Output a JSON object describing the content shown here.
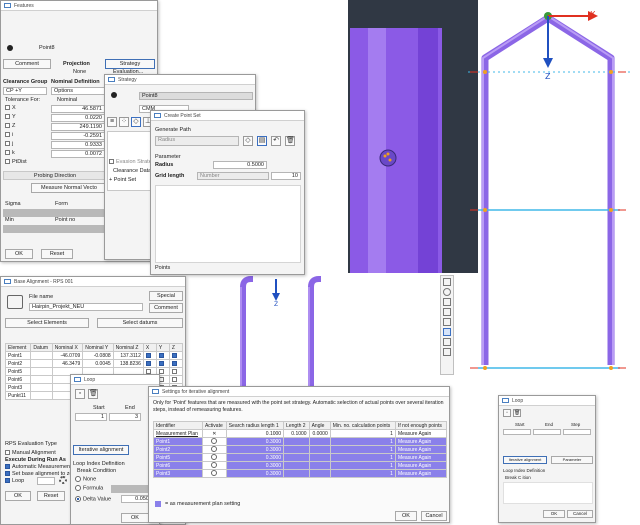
{
  "features_win": {
    "title": "Features",
    "item": "Point8",
    "tabs": [
      "Comment",
      "Projection",
      "Strategy"
    ],
    "projection_value": "None",
    "strategy_value": "Evaluation...",
    "clearance_group_label": "Clearance Group",
    "clearance_group_value": "CP +Y",
    "nominal_def_label": "Nominal Definition",
    "nominal_def_value": "Options",
    "tolerance_label": "Tolerance For:",
    "nominal_label": "Nominal",
    "rows": [
      {
        "label": "X",
        "value": "46.5871"
      },
      {
        "label": "Y",
        "value": "0.0220"
      },
      {
        "label": "Z",
        "value": "249.1190"
      },
      {
        "label": "i",
        "value": "-0.2591"
      },
      {
        "label": "j",
        "value": "0.9333"
      },
      {
        "label": "k",
        "value": "0.0072"
      }
    ],
    "ptdist_label": "PtDist",
    "probing_direction": "Probing Direction",
    "measure_normal": "Measure Normal Vecto",
    "sigma": "Sigma",
    "form": "Form",
    "min": "Min",
    "point_no": "Point no",
    "ok": "OK",
    "reset": "Reset"
  },
  "strategy_win": {
    "title": "Strategy",
    "item": "Point8",
    "mode": "CMM",
    "evasion": "Evasion Strate",
    "clearance_data": "Clearance Data",
    "point_set": "Point Set"
  },
  "create_pointset_win": {
    "title": "Create Point Set",
    "generate_path": "Generate Path",
    "path_value": "Radius",
    "parameter": "Parameter",
    "radius_label": "Radius",
    "radius_value": "0.5000",
    "grid_label": "Grid length",
    "grid_mode": "Number",
    "grid_value": "10",
    "points": "Points"
  },
  "viewport_right": {
    "x_label": "X",
    "z_label": "Z"
  },
  "viewport_bottom": {
    "z_label": "Z"
  },
  "base_alignment_win": {
    "title": "Base Alignment - RPS 001",
    "file_name_label": "File name",
    "file_name_value": "Hairpin_Projekt_NEU",
    "special": "Special",
    "comment": "Comment",
    "select_elements": "Select Elements",
    "select_datums": "Select datums",
    "columns": [
      "Element",
      "Datum",
      "Nominal X",
      "Nominal Y",
      "Nominal Z",
      "X",
      "Y",
      "Z"
    ],
    "rows": [
      {
        "element": "Point1",
        "datum": "",
        "nx": "-46.0709",
        "ny": "-0.0808",
        "nz": "137.3112"
      },
      {
        "element": "Point2",
        "datum": "",
        "nx": "46.3479",
        "ny": "0.0045",
        "nz": "138.8236"
      },
      {
        "element": "Point5",
        "datum": "",
        "nx": "",
        "ny": "",
        "nz": ""
      },
      {
        "element": "Point6",
        "datum": "",
        "nx": "",
        "ny": "",
        "nz": ""
      },
      {
        "element": "Point3",
        "datum": "",
        "nx": "",
        "ny": "",
        "nz": ""
      },
      {
        "element": "Punkt11",
        "datum": "",
        "nx": "",
        "ny": "",
        "nz": ""
      }
    ],
    "rps_eval_type": "RPS Evaluation Type",
    "manual_alignment": "Manual Alignment",
    "execute_during_run": "Execute During Run As",
    "automatic_measurement": "Automatic Measurement",
    "set_base_alignment": "Set base alignment to zero",
    "loop": "Loop",
    "ok": "OK",
    "reset": "Reset"
  },
  "loop_win": {
    "title": "Loop",
    "start_label": "Start",
    "end_label": "End",
    "start_value": "1",
    "end_value": "3",
    "iterative_alignment": "Iterative alignment",
    "loop_index_def": "Loop Index Definition",
    "break_condition": "Break Condition",
    "none": "None",
    "formula": "Formula",
    "delta_value": "Delta Value",
    "delta_num": "0.0500",
    "ok": "OK"
  },
  "iterative_win": {
    "title": "Settings for iterative alignment",
    "description": "Only for 'Point' features that are measured with the point set strategy. Automatic selection of actual points over several iteration steps, instead of remeasuring features.",
    "columns": [
      "Identifier",
      "Activate",
      "Search radius length 1",
      "Length 2",
      "Angle",
      "Min. no. calculation points",
      "If not enough points"
    ],
    "plan_row": {
      "id": "Measurement Plan",
      "r": "0.1000",
      "l2": "0.1000",
      "angle": "0.0000",
      "min": "1",
      "action": "Measure Again"
    },
    "rows": [
      {
        "id": "Point1",
        "r": "0.3000",
        "min": "1",
        "action": "Measure Again"
      },
      {
        "id": "Point2",
        "r": "0.3000",
        "min": "1",
        "action": "Measure Again"
      },
      {
        "id": "Point5",
        "r": "0.3000",
        "min": "1",
        "action": "Measure Again"
      },
      {
        "id": "Point6",
        "r": "0.3000",
        "min": "1",
        "action": "Measure Again"
      },
      {
        "id": "Point3",
        "r": "0.3000",
        "min": "1",
        "action": "Measure Again"
      }
    ],
    "legend": "= as measurement plan setting",
    "ok": "OK",
    "cancel": "Cancel"
  },
  "loop_small_win": {
    "title": "Loop",
    "start": "Start",
    "end": "End",
    "step": "Step",
    "iterative_alignment": "Iterative alignment",
    "parameter": "Parameter",
    "loop_index_def": "Loop Index Definition",
    "break_c": "Break C",
    "ditto": "ition",
    "ok": "OK",
    "cancel": "Cancel"
  }
}
